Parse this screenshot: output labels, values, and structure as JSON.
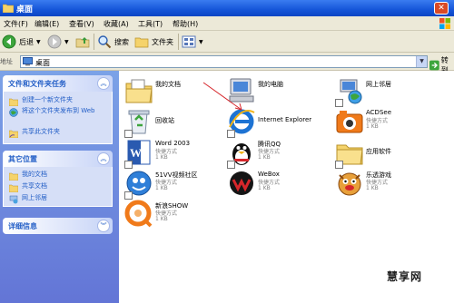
{
  "window": {
    "title": "桌面"
  },
  "menu": [
    "文件(F)",
    "编辑(E)",
    "查看(V)",
    "收藏(A)",
    "工具(T)",
    "帮助(H)"
  ],
  "toolbar": {
    "back": "后退",
    "search": "搜索",
    "folders": "文件夹"
  },
  "address": {
    "label": "地址",
    "value": "桌面",
    "go": "转到"
  },
  "tasks": {
    "file_title": "文件和文件夹任务",
    "file_items": [
      "创建一个新文件夹",
      "将这个文件夹发布到 Web",
      "共享此文件夹"
    ],
    "other_title": "其它位置",
    "other_items": [
      "我的文档",
      "共享文档",
      "网上邻居"
    ],
    "details_title": "详细信息"
  },
  "items": [
    {
      "name": "我的文档"
    },
    {
      "name": "我的电脑"
    },
    {
      "name": "网上邻居"
    },
    {
      "name": "回收站"
    },
    {
      "name": "Internet Explorer"
    },
    {
      "name": "ACDSee",
      "sub1": "快捷方式",
      "sub2": "1 KB"
    },
    {
      "name": "Word 2003",
      "sub1": "快捷方式",
      "sub2": "1 KB"
    },
    {
      "name": "腾讯QQ",
      "sub1": "快捷方式",
      "sub2": "1 KB"
    },
    {
      "name": "应用软件"
    },
    {
      "name": "51VV视频社区",
      "sub1": "快捷方式",
      "sub2": "1 KB"
    },
    {
      "name": "WeBox",
      "sub1": "快捷方式",
      "sub2": "1 KB"
    },
    {
      "name": "乐透游戏",
      "sub1": "快捷方式",
      "sub2": "1 KB"
    },
    {
      "name": "新浪SHOW",
      "sub1": "快捷方式",
      "sub2": "1 KB"
    }
  ],
  "watermark": "慧享网"
}
